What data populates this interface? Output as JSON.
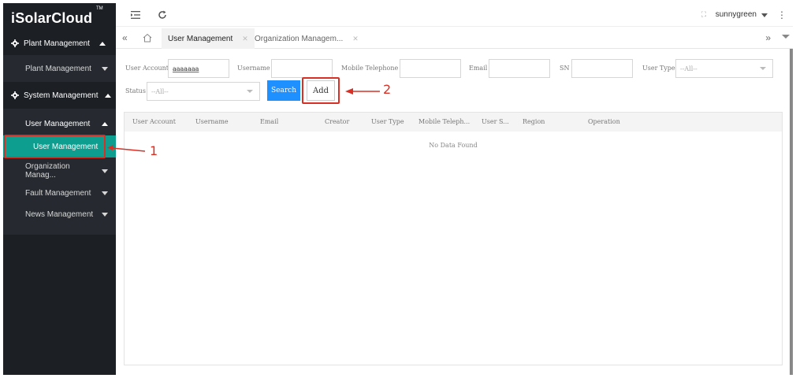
{
  "app": {
    "logo": "iSolarCloud",
    "trademark": "TM"
  },
  "sidebar": {
    "sections": [
      {
        "label": "Plant Management",
        "icon": "gear-icon",
        "children": [
          {
            "label": "Plant Management"
          }
        ]
      },
      {
        "label": "System Management",
        "icon": "gear-icon",
        "children": [
          {
            "label": "User Management",
            "leaf": "User Management"
          },
          {
            "label": "Organization Manag..."
          },
          {
            "label": "Fault Management"
          },
          {
            "label": "News Management"
          }
        ]
      }
    ]
  },
  "topbar": {
    "user": "sunnygreen",
    "menu_icon": "menu-fold-icon",
    "refresh_icon": "refresh-icon",
    "more_icon": "more-vertical-icon"
  },
  "tabs": [
    {
      "label": "User Management",
      "active": true
    },
    {
      "label": "Organization Managem...",
      "active": false
    }
  ],
  "filters": {
    "user_account": {
      "label": "User Account",
      "value": "aaaaaaa"
    },
    "username": {
      "label": "Username",
      "value": ""
    },
    "mobile": {
      "label": "Mobile Telephone",
      "value": ""
    },
    "email": {
      "label": "Email",
      "value": ""
    },
    "sn": {
      "label": "SN",
      "value": ""
    },
    "user_type": {
      "label": "User Type",
      "value": "--All--"
    },
    "status": {
      "label": "Status",
      "value": "--All--"
    },
    "search_label": "Search",
    "add_label": "Add"
  },
  "table": {
    "columns": [
      "User Account",
      "Username",
      "Email",
      "Creator",
      "User Type",
      "Mobile Teleph...",
      "User S...",
      "Region",
      "Operation"
    ],
    "empty_text": "No Data Found"
  },
  "annotations": {
    "one": "1",
    "two": "2"
  },
  "colors": {
    "accent": "#0e9e8f",
    "primary_button": "#1e90ff",
    "sidebar_bg": "#1c1f24",
    "annotation": "#d93025"
  }
}
